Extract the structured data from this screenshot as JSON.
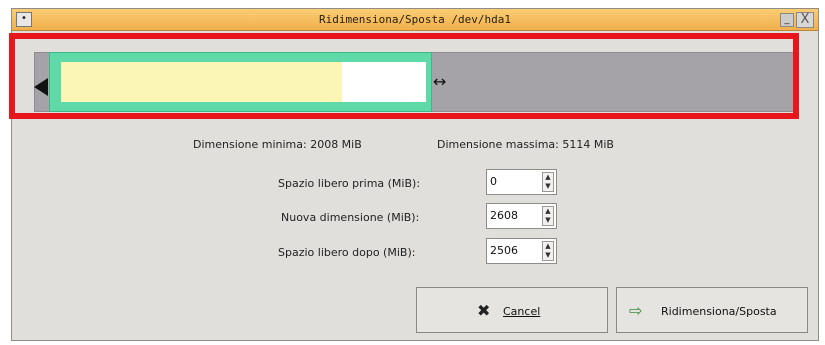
{
  "window": {
    "title": "Ridimensiona/Sposta /dev/hda1",
    "menu_symbol": "•",
    "minimize_symbol": "_",
    "close_symbol": "X"
  },
  "partition_bar": {
    "handle_symbol": "↔",
    "used_fraction": 0.73,
    "colors": {
      "partition": "#5fd9a8",
      "used": "#fbf6b6",
      "unused": "#ffffff",
      "free": "#a5a3a8",
      "highlight": "#e8171d"
    }
  },
  "limits": {
    "min_label": "Dimensione minima: 2008 MiB",
    "max_label": "Dimensione massima: 5114 MiB"
  },
  "fields": {
    "free_before": {
      "label": "Spazio libero prima (MiB):",
      "value": "0"
    },
    "new_size": {
      "label": "Nuova dimensione (MiB):",
      "value": "2608"
    },
    "free_after": {
      "label": "Spazio libero dopo (MiB):",
      "value": "2506"
    }
  },
  "buttons": {
    "cancel": {
      "label": "Cancel",
      "icon": "x-icon"
    },
    "resize": {
      "label": "Ridimensiona/Sposta",
      "icon": "resize-move-icon"
    }
  }
}
